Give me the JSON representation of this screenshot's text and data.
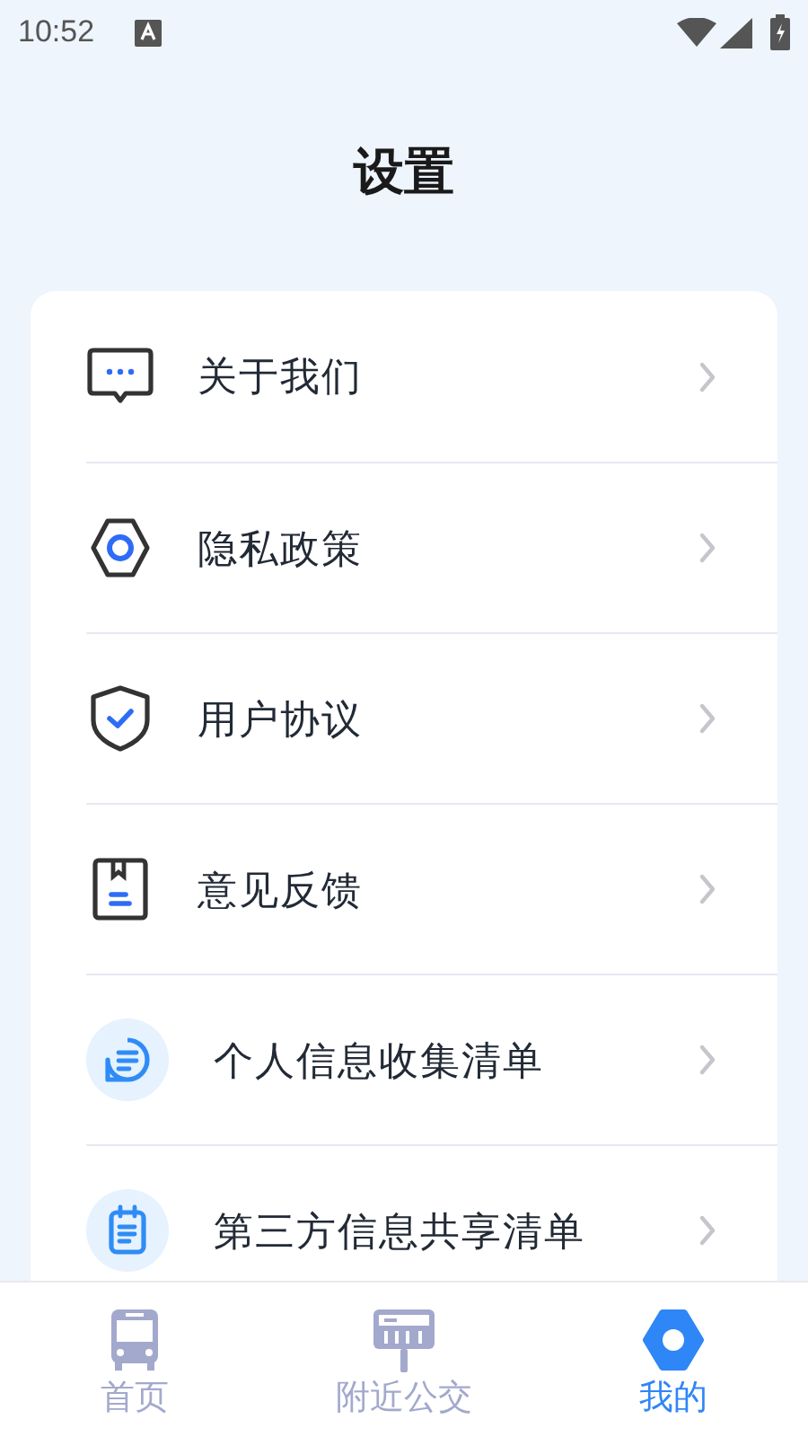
{
  "status_bar": {
    "time": "10:52"
  },
  "title": "设置",
  "menu": [
    {
      "kind": "chat",
      "label": "关于我们"
    },
    {
      "kind": "gear",
      "label": "隐私政策"
    },
    {
      "kind": "shield",
      "label": "用户协议"
    },
    {
      "kind": "book",
      "label": "意见反馈"
    },
    {
      "kind": "message",
      "label": "个人信息收集清单"
    },
    {
      "kind": "clipboard",
      "label": "第三方信息共享清单"
    }
  ],
  "tabs": [
    {
      "kind": "bus",
      "label": "首页",
      "selected": false
    },
    {
      "kind": "stop",
      "label": "附近公交",
      "selected": false
    },
    {
      "kind": "gear",
      "label": "我的",
      "selected": true
    }
  ]
}
